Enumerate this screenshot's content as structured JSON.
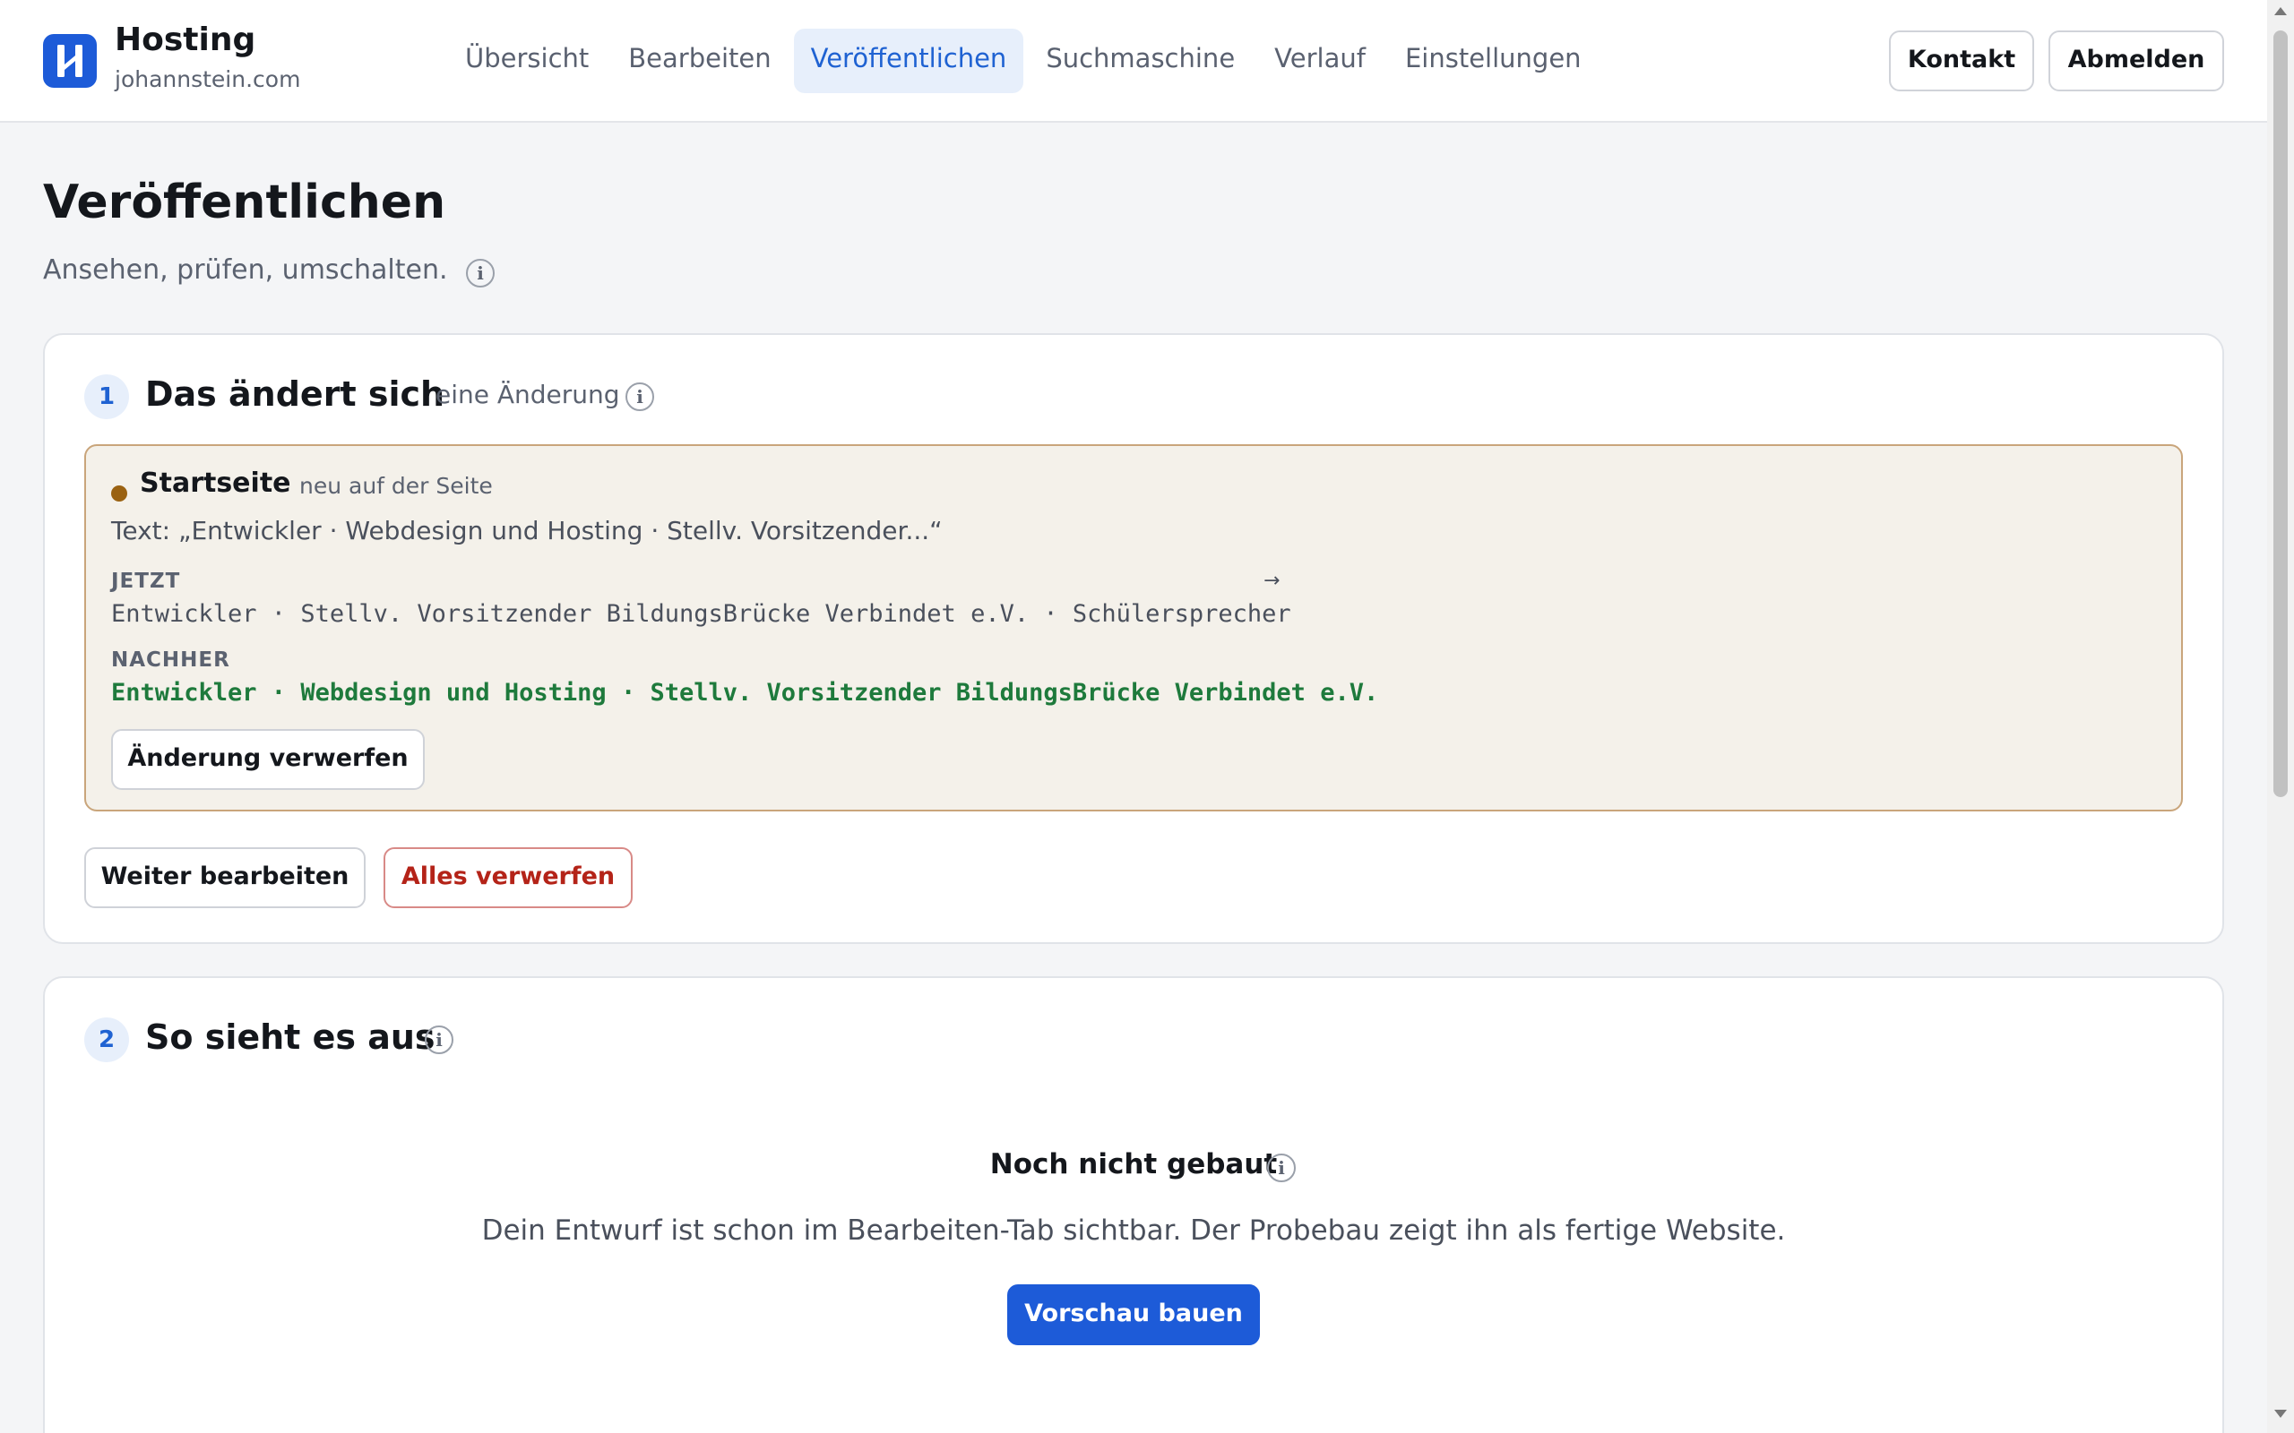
{
  "header": {
    "brand_title": "Hosting",
    "brand_subtitle": "johannstein.com",
    "logo_icon": "hosting-logo-h",
    "nav": [
      {
        "label": "Übersicht",
        "active": false
      },
      {
        "label": "Bearbeiten",
        "active": false
      },
      {
        "label": "Veröffentlichen",
        "active": true
      },
      {
        "label": "Suchmaschine",
        "active": false
      },
      {
        "label": "Verlauf",
        "active": false
      },
      {
        "label": "Einstellungen",
        "active": false
      }
    ],
    "contact_label": "Kontakt",
    "logout_label": "Abmelden"
  },
  "page": {
    "title": "Veröffentlichen",
    "subtitle": "Ansehen, prüfen, umschalten."
  },
  "section1": {
    "number": "1",
    "title": "Das ändert sich",
    "count": "eine Änderung",
    "change": {
      "name": "Startseite",
      "tag": "neu auf der Seite",
      "text": "Text: „Entwickler · Webdesign und Hosting · Stellv. Vorsitzender...“",
      "now_label": "JETZT",
      "now_value": "Entwickler · Stellv. Vorsitzender BildungsBrücke Verbindet e.V. · Schülersprecher",
      "arrow": "→",
      "after_label": "NACHHER",
      "after_value": "Entwickler · Webdesign und Hosting · Stellv. Vorsitzender BildungsBrücke Verbindet e.V.",
      "discard_label": "Änderung verwerfen"
    },
    "continue_label": "Weiter bearbeiten",
    "discard_all_label": "Alles verwerfen"
  },
  "section2": {
    "number": "2",
    "title": "So sieht es aus",
    "empty_title": "Noch nicht gebaut",
    "empty_text": "Dein Entwurf ist schon im Bearbeiten-Tab sichtbar. Der Probebau zeigt ihn als fertige Website.",
    "build_label": "Vorschau bauen"
  },
  "info_glyph": "i",
  "colors": {
    "accent": "#1d5bd8",
    "active_nav_bg": "#e7effb",
    "change_bg": "#f4f1ea",
    "change_border": "#c9a57b",
    "change_dot": "#9a6212",
    "after_text": "#1e7a3c",
    "danger": "#b42318"
  }
}
